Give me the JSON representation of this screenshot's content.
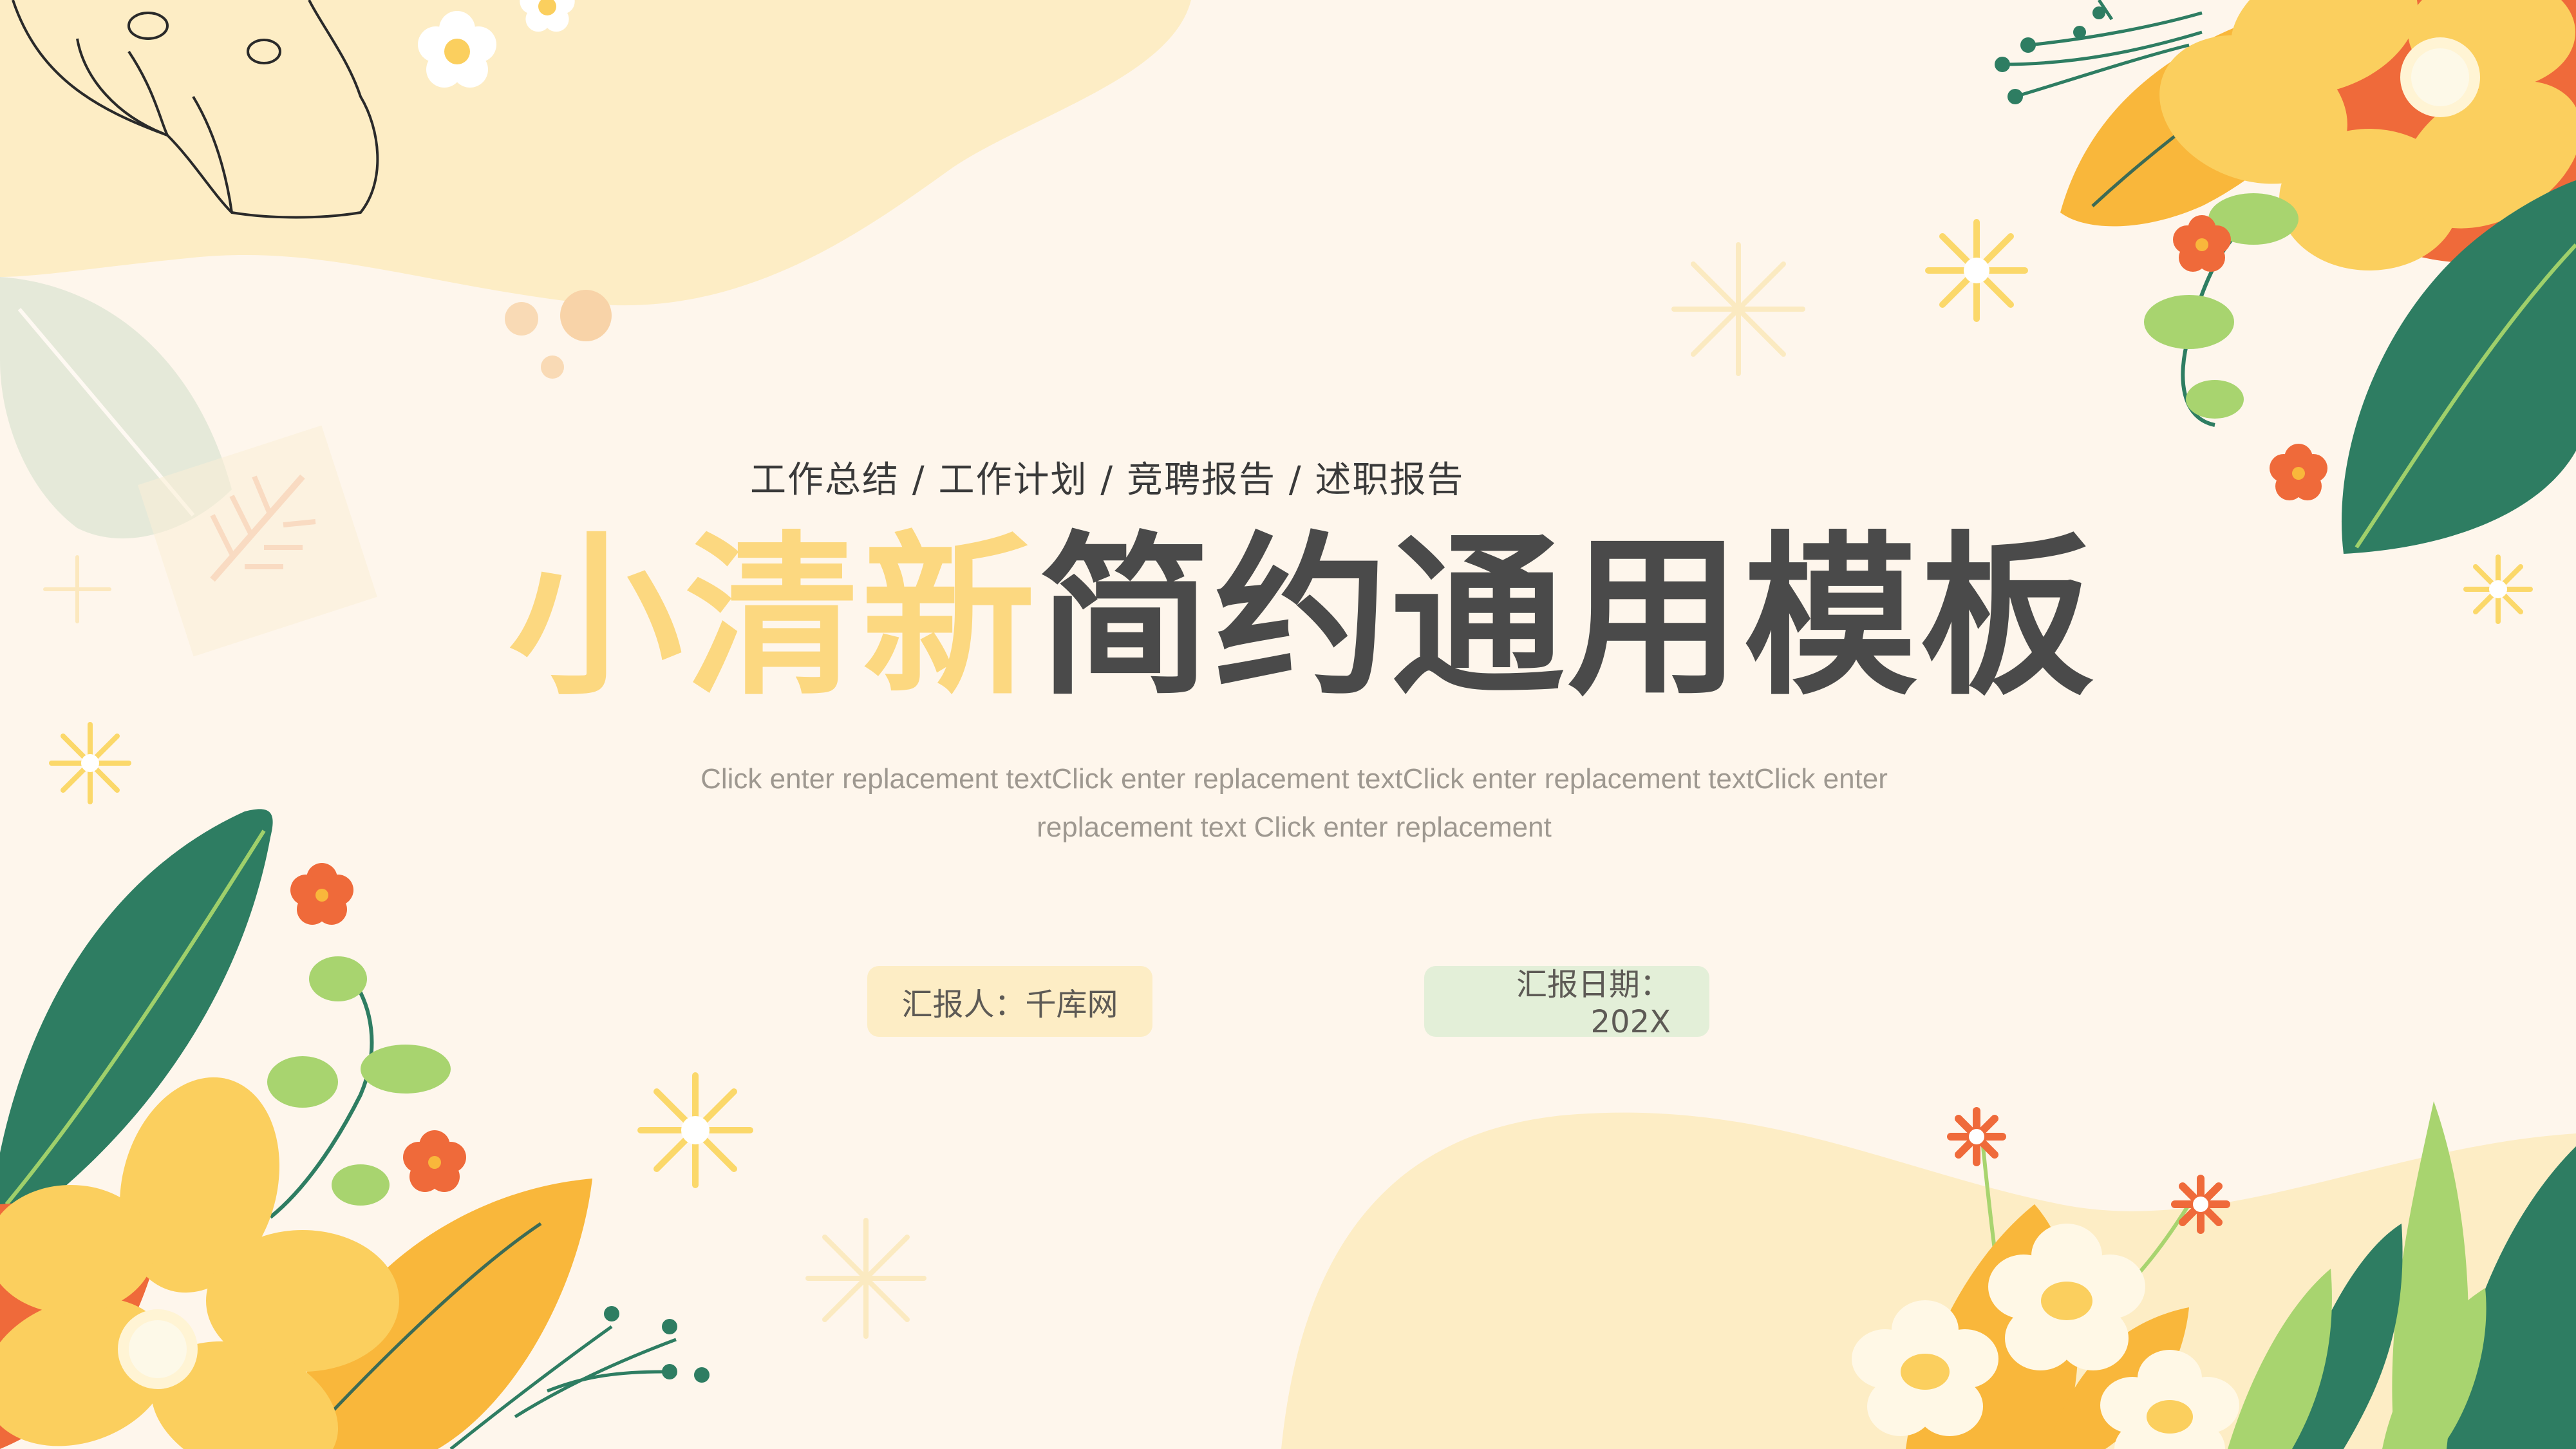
{
  "slide": {
    "categories": "工作总结 / 工作计划 / 竞聘报告 / 述职报告",
    "title_highlight": "小清新",
    "title_rest": "简约通用模板",
    "description": "Click enter replacement textClick enter replacement textClick enter replacement textClick enter replacement text Click enter replacement",
    "reporter": "汇报人：千库网",
    "date_label": "汇报日期：",
    "date_value": "202X"
  },
  "colors": {
    "background": "#fef6ec",
    "title_highlight": "#fcd880",
    "title_main": "#4a4a4a",
    "leaf_green": "#2e7d62",
    "flower_yellow": "#fbcf5e",
    "flower_orange": "#ef6a3a",
    "reporter_pill": "#fdedc5",
    "date_pill": "#e3efd8"
  }
}
